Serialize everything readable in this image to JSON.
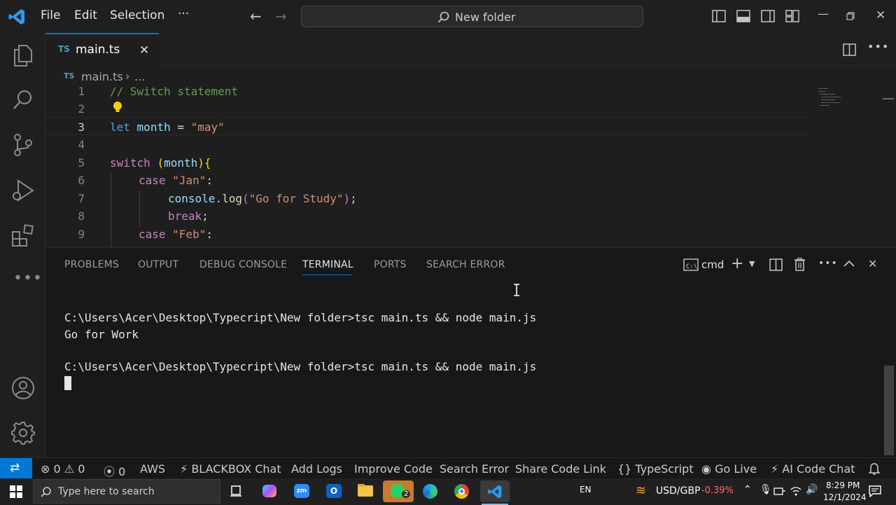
{
  "menu": {
    "file": "File",
    "edit": "Edit",
    "selection": "Selection",
    "more": "···"
  },
  "search": {
    "label": "New folder"
  },
  "tab": {
    "badge": "TS",
    "filename": "main.ts",
    "close": "✕"
  },
  "breadcrumb": {
    "badge": "TS",
    "file": "main.ts",
    "sep": "›",
    "more": "..."
  },
  "editor": {
    "line_numbers": [
      "1",
      "2",
      "3",
      "4",
      "5",
      "6",
      "7",
      "8",
      "9"
    ],
    "comment": "// Switch statement",
    "line3": {
      "kw": "let",
      "var": "month",
      "eq": " = ",
      "str": "\"may\""
    },
    "line5": {
      "kw": "switch",
      "open": "(",
      "var": "month",
      "close": ")",
      "brace": "{"
    },
    "line6": {
      "kw": "case",
      "str": "\"Jan\"",
      "colon": ":"
    },
    "line7": {
      "obj": "console",
      "dot": ".",
      "fn": "log",
      "open": "(",
      "str": "\"Go for Study\"",
      "close": ")",
      "semi": ";"
    },
    "line8": {
      "kw": "break",
      "semi": ";"
    },
    "line9": {
      "kw": "case",
      "str": "\"Feb\"",
      "colon": ":"
    }
  },
  "panel": {
    "tabs": [
      "PROBLEMS",
      "OUTPUT",
      "DEBUG CONSOLE",
      "TERMINAL",
      "PORTS",
      "SEARCH ERROR"
    ],
    "shell": "cmd",
    "terminal": {
      "line1": "C:\\Users\\Acer\\Desktop\\Typecript\\New folder>tsc main.ts && node main.js",
      "line2": "Go for Work",
      "line3": "C:\\Users\\Acer\\Desktop\\Typecript\\New folder>tsc main.ts && node main.js"
    }
  },
  "status": {
    "errors": "0",
    "warnings": "0",
    "ports": "0",
    "aws": "AWS",
    "blackbox": "BLACKBOX Chat",
    "add_logs": "Add Logs",
    "improve": "Improve Code",
    "search_error": "Search Error",
    "share": "Share Code Link",
    "lang": "TypeScript",
    "golive": "Go Live",
    "ai": "AI Code Chat"
  },
  "taskbar": {
    "search_placeholder": "Type here to search",
    "lang": "EN",
    "ticker": "USD/GBP",
    "change": "-0.39%",
    "time": "8:29 PM",
    "date": "12/1/2024",
    "whatsapp_badge": "2"
  },
  "colors": {
    "accent": "#0078d4",
    "status_left": "#0078d4",
    "negative": "#ff6b6b"
  }
}
